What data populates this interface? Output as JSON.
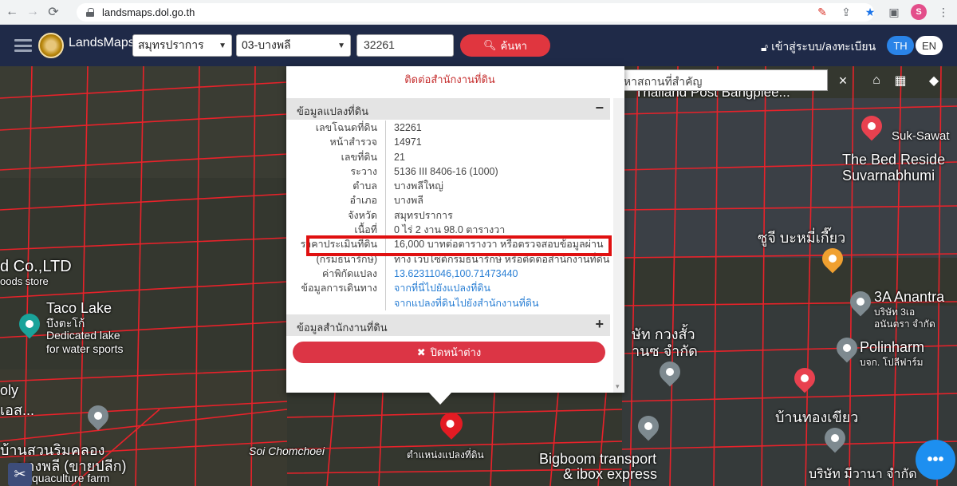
{
  "browser": {
    "url": "landsmaps.dol.go.th",
    "profile_initial": "S"
  },
  "header": {
    "brand": "LandsMaps",
    "province": "สมุทรปราการ",
    "district": "03-บางพลี",
    "parcel_number": "32261",
    "search_label": "ค้นหา",
    "login_label": "เข้าสู่ระบบ/ลงทะเบียน",
    "lang_th": "TH",
    "lang_en": "EN",
    "accent_color": "#e0363f",
    "header_color": "#1f2a48"
  },
  "map_controls": {
    "place_search_placeholder": "ค้นหาสถานที่สำคัญ",
    "clear_symbol": "×"
  },
  "popup": {
    "notice": "ติดต่อสำนักงานที่ดิน",
    "section_parcel": "ข้อมูลแปลงที่ดิน",
    "section_office": "ข้อมูลสำนักงานที่ดิน",
    "close_label": "ปิดหน้าต่าง",
    "rows": [
      {
        "k": "เลขโฉนดที่ดิน",
        "v": "32261"
      },
      {
        "k": "หน้าสำรวจ",
        "v": "14971"
      },
      {
        "k": "เลขที่ดิน",
        "v": "21"
      },
      {
        "k": "ระวาง",
        "v": "5136 III 8406-16 (1000)"
      },
      {
        "k": "ตำบล",
        "v": "บางพลีใหญ่"
      },
      {
        "k": "อำเภอ",
        "v": "บางพลี"
      },
      {
        "k": "จังหวัด",
        "v": "สมุทรปราการ"
      },
      {
        "k": "เนื้อที่",
        "v": "0 ไร่ 2 งาน 98.0 ตารางวา"
      },
      {
        "k": "ราคาประเมินที่ดิน",
        "v": "16,000 บาทต่อตารางวา หรือตรวจสอบข้อมูลผ่าน"
      },
      {
        "k": "(กรมธนารักษ์)",
        "v": "ทาง เว็บไซต์กรมธนารักษ์ หรือติดต่อสำนักงานที่ดิน"
      },
      {
        "k": "ค่าพิกัดแปลง",
        "v": "13.62311046,100.71473440"
      },
      {
        "k": "ข้อมูลการเดินทาง",
        "v": "จากที่นี่ไปยังแปลงที่ดิน"
      },
      {
        "k": "",
        "v": "จากแปลงที่ดินไปยังสำนักงานที่ดิน"
      }
    ]
  },
  "map_labels": {
    "thailand_post": "Thailand Post Bangplee...",
    "suksawat": "Suk-Sawat",
    "bed_reside": "The Bed Reside",
    "suvarnabhumi": "Suvarnabhumi",
    "soi_bamee": "ซูจี บะหมี่เกี๊ยว",
    "co_ltd": "d Co.,LTD",
    "goods_store": "oods store",
    "taco_lake": "Taco Lake",
    "bueng_lake": "บึงตะโก้",
    "dedicated": "Dedicated lake",
    "water_sports": "for water sports",
    "ply": "oly",
    "ply2": "เอส...",
    "kongsua": "ษัท กวงสั้ว",
    "kongsua2": "านซ จำกัด",
    "anantra": "3A Anantra",
    "anantra2": "บริษัท 3เอ",
    "anantra3": "อนันตรา จำกัด",
    "polinharm": "Polinharm",
    "polinharm2": "บจก. โปลีฟาร์ม",
    "ban_thong": "บ้านทองเขียว",
    "ban_suan": "บ้านสวนริมคลอง",
    "ban_suan2": "บางพลี (ขายปลีก)",
    "aquaculture": "quaculture farm",
    "soi_chomchoei": "Soi Chomchoei",
    "parcel_position": "ตำแหน่งแปลงที่ดิน",
    "bigboom": "Bigboom transport",
    "ibox": "& ibox express",
    "mivana": "บริษัท มีวานา จำกัด"
  }
}
